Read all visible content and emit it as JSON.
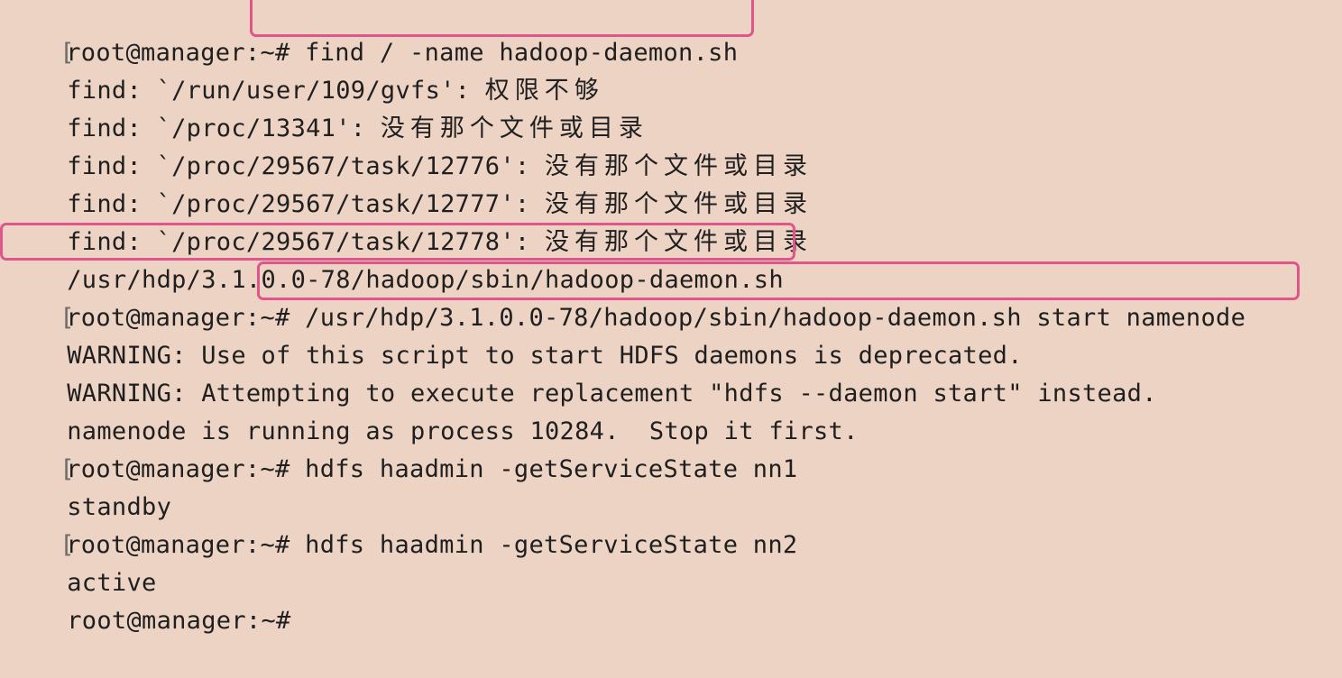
{
  "terminal": {
    "prompt": "root@manager:~#",
    "lines": [
      {
        "kind": "cmd",
        "text": "find / -name hadoop-daemon.sh"
      },
      {
        "kind": "out",
        "prefix": "find: `/run/user/109/gvfs': ",
        "msg": "权限不够"
      },
      {
        "kind": "out",
        "prefix": "find: `/proc/13341': ",
        "msg": "没有那个文件或目录"
      },
      {
        "kind": "out",
        "prefix": "find: `/proc/29567/task/12776': ",
        "msg": "没有那个文件或目录"
      },
      {
        "kind": "out",
        "prefix": "find: `/proc/29567/task/12777': ",
        "msg": "没有那个文件或目录"
      },
      {
        "kind": "out",
        "prefix": "find: `/proc/29567/task/12778': ",
        "msg": "没有那个文件或目录"
      },
      {
        "kind": "out",
        "text": "/usr/hdp/3.1.0.0-78/hadoop/sbin/hadoop-daemon.sh"
      },
      {
        "kind": "cmd",
        "text": "/usr/hdp/3.1.0.0-78/hadoop/sbin/hadoop-daemon.sh start namenode"
      },
      {
        "kind": "out",
        "text": "WARNING: Use of this script to start HDFS daemons is deprecated."
      },
      {
        "kind": "out",
        "text": "WARNING: Attempting to execute replacement \"hdfs --daemon start\" instead."
      },
      {
        "kind": "out",
        "text": "namenode is running as process 10284.  Stop it first."
      },
      {
        "kind": "cmd",
        "text": "hdfs haadmin -getServiceState nn1"
      },
      {
        "kind": "out",
        "text": "standby"
      },
      {
        "kind": "cmd",
        "text": "hdfs haadmin -getServiceState nn2"
      },
      {
        "kind": "out",
        "text": "active"
      },
      {
        "kind": "cmd",
        "text": ""
      }
    ]
  },
  "colors": {
    "background": "#ecd3c4",
    "text": "#1f1f1f",
    "highlight_border": "#e0558a"
  }
}
